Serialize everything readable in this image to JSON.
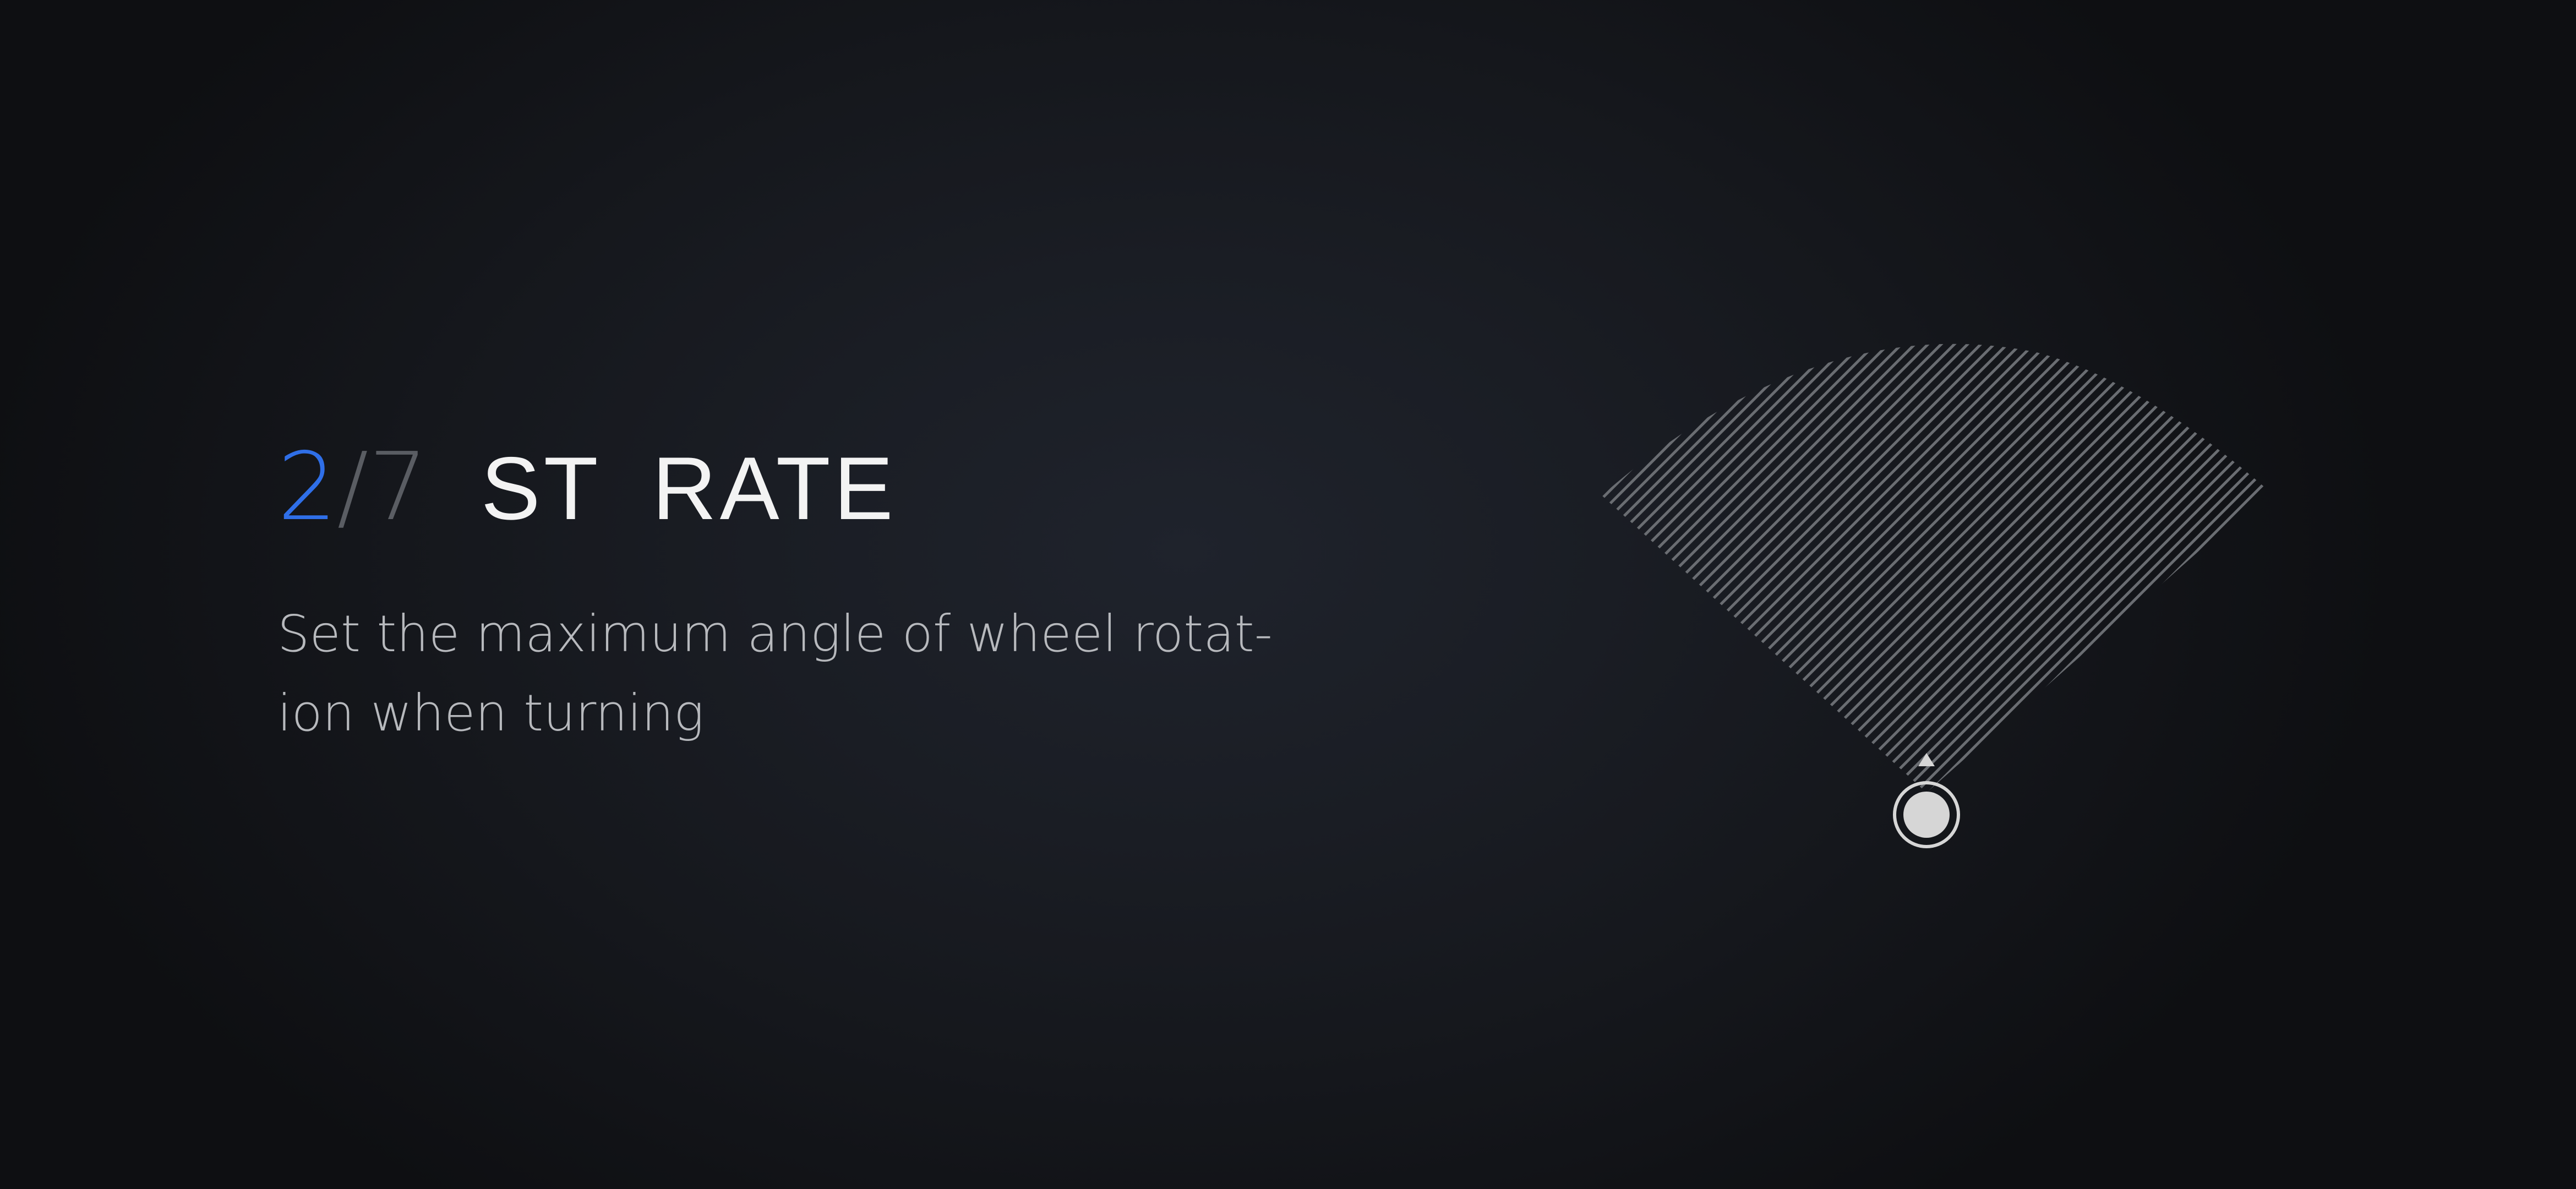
{
  "step": {
    "current": "2",
    "separator": "/",
    "total": "7"
  },
  "title": "ST RATE",
  "description": {
    "line1": "Set the maximum angle of wheel rotat-",
    "line2": "ion when turning"
  },
  "colors": {
    "accent": "#2f6fe8",
    "muted": "#5a5d63",
    "title": "#f3f3f3",
    "body_text": "#b7b9bd",
    "sector_lines": "#6a6d72",
    "knob": "#d6d6d6"
  },
  "icons": {
    "indicator": "triangle-up-icon",
    "knob": "circle-knob-icon"
  }
}
